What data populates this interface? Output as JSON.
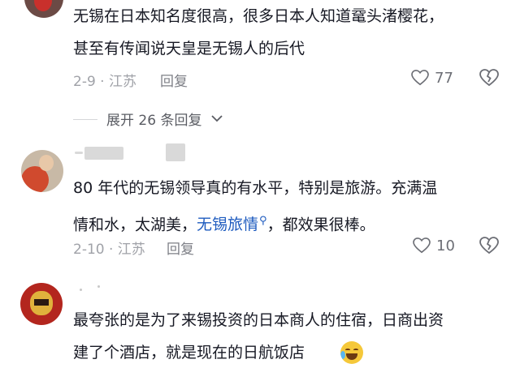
{
  "comments": [
    {
      "line1": "无锡在日本知名度很高，很多日本人知道鼋头渚樱花，",
      "line2": "甚至有传闻说天皇是无锡人的后代",
      "date_location": "2-9 · 江苏",
      "reply_label": "回复",
      "likes": "77",
      "expand_label": "展开 26 条回复"
    },
    {
      "line1": "80 年代的无锡领导真的有水平，特别是旅游。充满温",
      "line2_before": "情和水，太湖美，",
      "line2_link": "无锡旅情",
      "line2_after": "，都效果很棒。",
      "date_location": "2-10 · 江苏",
      "reply_label": "回复",
      "likes": "10"
    },
    {
      "line1": "最夸张的是为了来锡投资的日本商人的住宿，日商出资",
      "line2": "建了个酒店，就是现在的日航饭店"
    }
  ],
  "icons": {
    "like": "heart-icon",
    "dislike": "broken-heart-icon",
    "expand": "chevron-down-icon",
    "search": "search-icon",
    "emoji": "rofl-emoji"
  },
  "colors": {
    "text": "#161823",
    "meta": "#a0a2a8",
    "link": "#1e5bbf"
  }
}
